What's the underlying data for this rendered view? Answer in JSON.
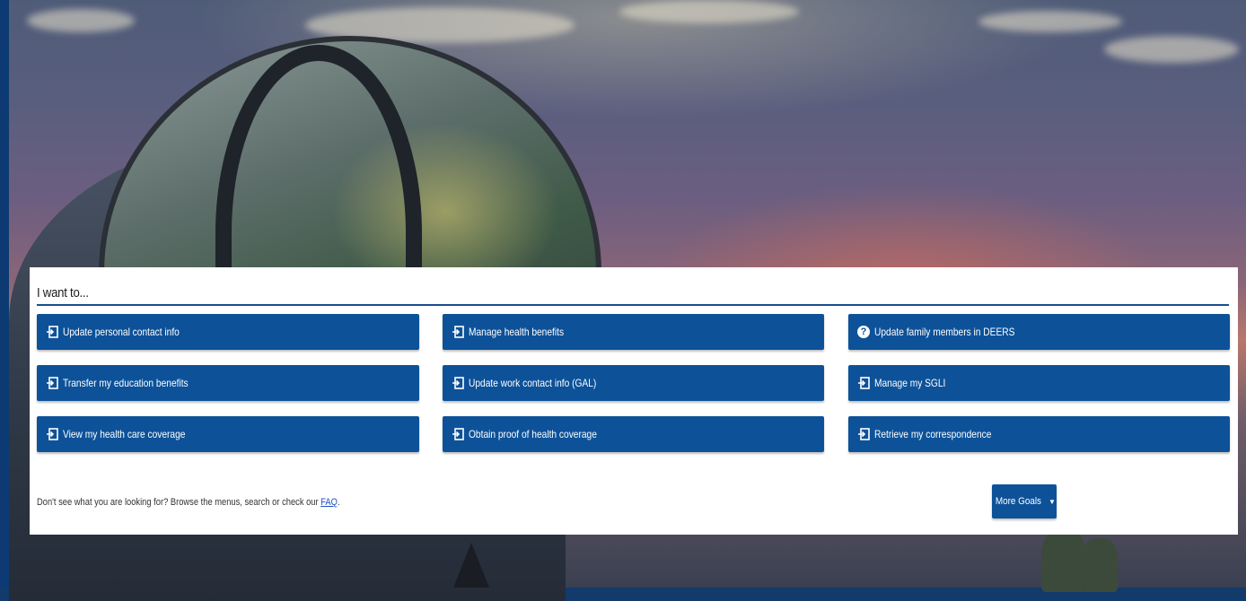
{
  "panel": {
    "title": "I want to...",
    "goals": [
      {
        "label": "Update personal contact info",
        "icon": "sign-in-icon"
      },
      {
        "label": "Manage health benefits",
        "icon": "sign-in-icon"
      },
      {
        "label": "Update family members in DEERS",
        "icon": "help-circle-icon"
      },
      {
        "label": "Transfer my education benefits",
        "icon": "sign-in-icon"
      },
      {
        "label": "Update work contact info (GAL)",
        "icon": "sign-in-icon"
      },
      {
        "label": "Manage my SGLI",
        "icon": "sign-in-icon"
      },
      {
        "label": "View my health care coverage",
        "icon": "sign-in-icon"
      },
      {
        "label": "Obtain proof of health coverage",
        "icon": "sign-in-icon"
      },
      {
        "label": "Retrieve my correspondence",
        "icon": "sign-in-icon"
      }
    ],
    "footer_text": "Don't see what you are looking for? Browse the menus, search or check our",
    "faq_link": "FAQ",
    "footer_end": ".",
    "more_goals_label": "More Goals",
    "caret_icon": "caret-down-icon"
  },
  "colors": {
    "button_blue": "#0d5299",
    "rule_blue": "#1b4f8f",
    "link_blue": "#1a4fc4"
  }
}
